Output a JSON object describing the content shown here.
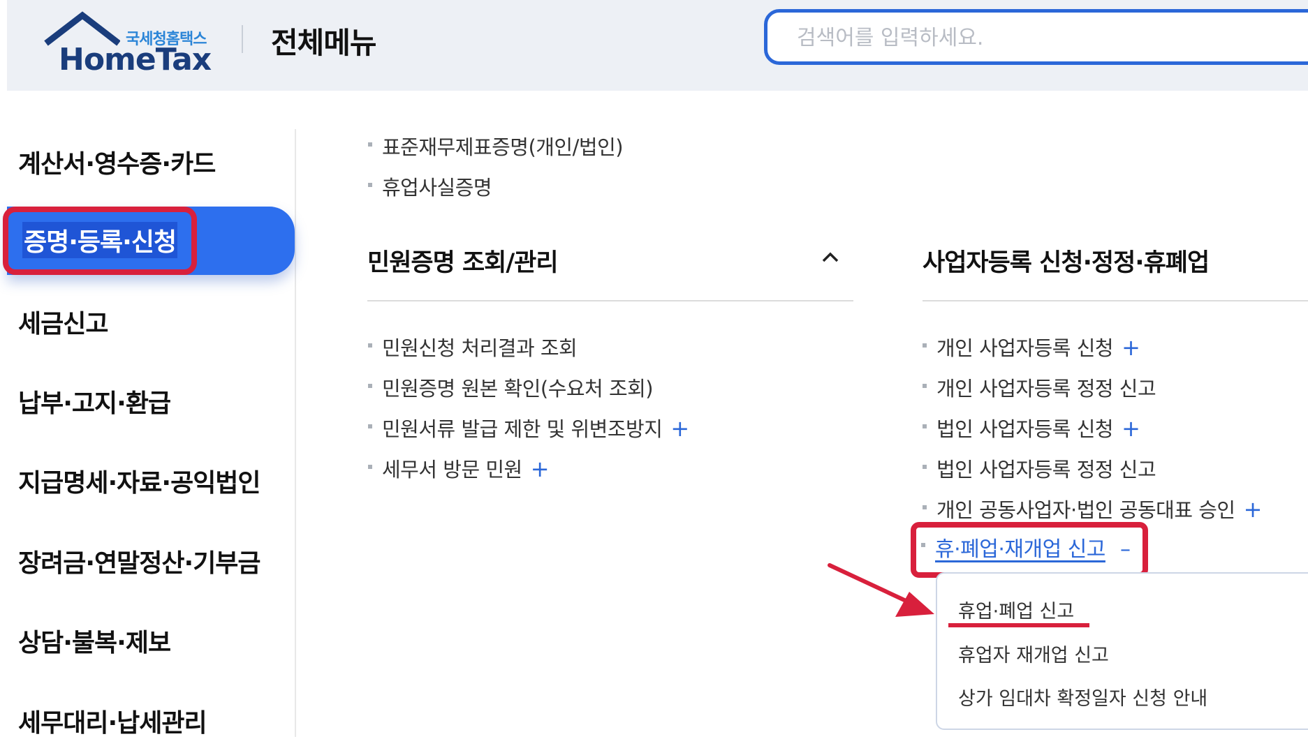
{
  "header": {
    "logo_kr": "국세청홈택스",
    "logo_en": "HomeTax",
    "page_title": "전체메뉴",
    "search_placeholder": "검색어를 입력하세요."
  },
  "sidebar": {
    "items": [
      {
        "label": "계산서·영수증·카드"
      },
      {
        "label": "증명·등록·신청",
        "active": true
      },
      {
        "label": "세금신고"
      },
      {
        "label": "납부·고지·환급"
      },
      {
        "label": "지급명세·자료·공익법인"
      },
      {
        "label": "장려금·연말정산·기부금"
      },
      {
        "label": "상담·불복·제보"
      },
      {
        "label": "세무대리·납세관리"
      }
    ]
  },
  "top_list": [
    {
      "label": "표준재무제표증명(개인/법인)"
    },
    {
      "label": "휴업사실증명"
    }
  ],
  "section_left": {
    "title": "민원증명 조회/관리",
    "items": [
      {
        "label": "민원신청 처리결과 조회",
        "plus": ""
      },
      {
        "label": "민원증명 원본 확인(수요처 조회)",
        "plus": ""
      },
      {
        "label": "민원서류 발급 제한 및 위변조방지",
        "plus": "+"
      },
      {
        "label": "세무서 방문 민원",
        "plus": "+"
      }
    ]
  },
  "section_right": {
    "title": "사업자등록 신청·정정·휴폐업",
    "items": [
      {
        "label": "개인 사업자등록 신청",
        "plus": "+"
      },
      {
        "label": "개인 사업자등록 정정 신고",
        "plus": ""
      },
      {
        "label": "법인 사업자등록 신청",
        "plus": "+"
      },
      {
        "label": "법인 사업자등록 정정 신고",
        "plus": ""
      },
      {
        "label": "개인 공동사업자·법인 공동대표 승인",
        "plus": "+"
      }
    ],
    "expanded": {
      "label": "휴·폐업·재개업 신고",
      "toggle": "–",
      "subitems": [
        {
          "label": "휴업·폐업 신고"
        },
        {
          "label": "휴업자 재개업 신고"
        },
        {
          "label": "상가 임대차 확정일자 신청 안내"
        }
      ]
    }
  },
  "colors": {
    "accent": "#2d6fee",
    "highlight": "#d8203c",
    "link": "#2b67d8",
    "header_bg": "#edf0f5"
  }
}
